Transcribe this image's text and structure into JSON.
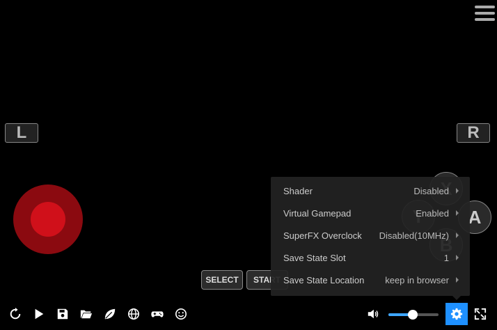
{
  "controls": {
    "l_label": "L",
    "r_label": "R",
    "face": {
      "x": "X",
      "y": "Y",
      "a": "A",
      "b": "B"
    },
    "select_label": "SELECT",
    "start_label": "START"
  },
  "settings_menu": {
    "items": [
      {
        "label": "Shader",
        "value": "Disabled"
      },
      {
        "label": "Virtual Gamepad",
        "value": "Enabled"
      },
      {
        "label": "SuperFX Overclock",
        "value": "Disabled(10MHz)"
      },
      {
        "label": "Save State Slot",
        "value": "1"
      },
      {
        "label": "Save State Location",
        "value": "keep in browser"
      }
    ]
  },
  "toolbar": {
    "left_icons": [
      "restart-icon",
      "play-icon",
      "save-icon",
      "folder-icon",
      "leaf-icon",
      "globe-icon",
      "gamepad-icon",
      "smiley-icon"
    ],
    "right_icons": [
      "volume-icon",
      "gear-icon",
      "fullscreen-icon"
    ],
    "volume_level": 0.49,
    "accent": "#1e90ff"
  },
  "colors": {
    "background": "#000000",
    "joystick_outer": "#8b0a10",
    "joystick_inner": "#d0101a",
    "volume_fill": "#3ea6ff"
  }
}
